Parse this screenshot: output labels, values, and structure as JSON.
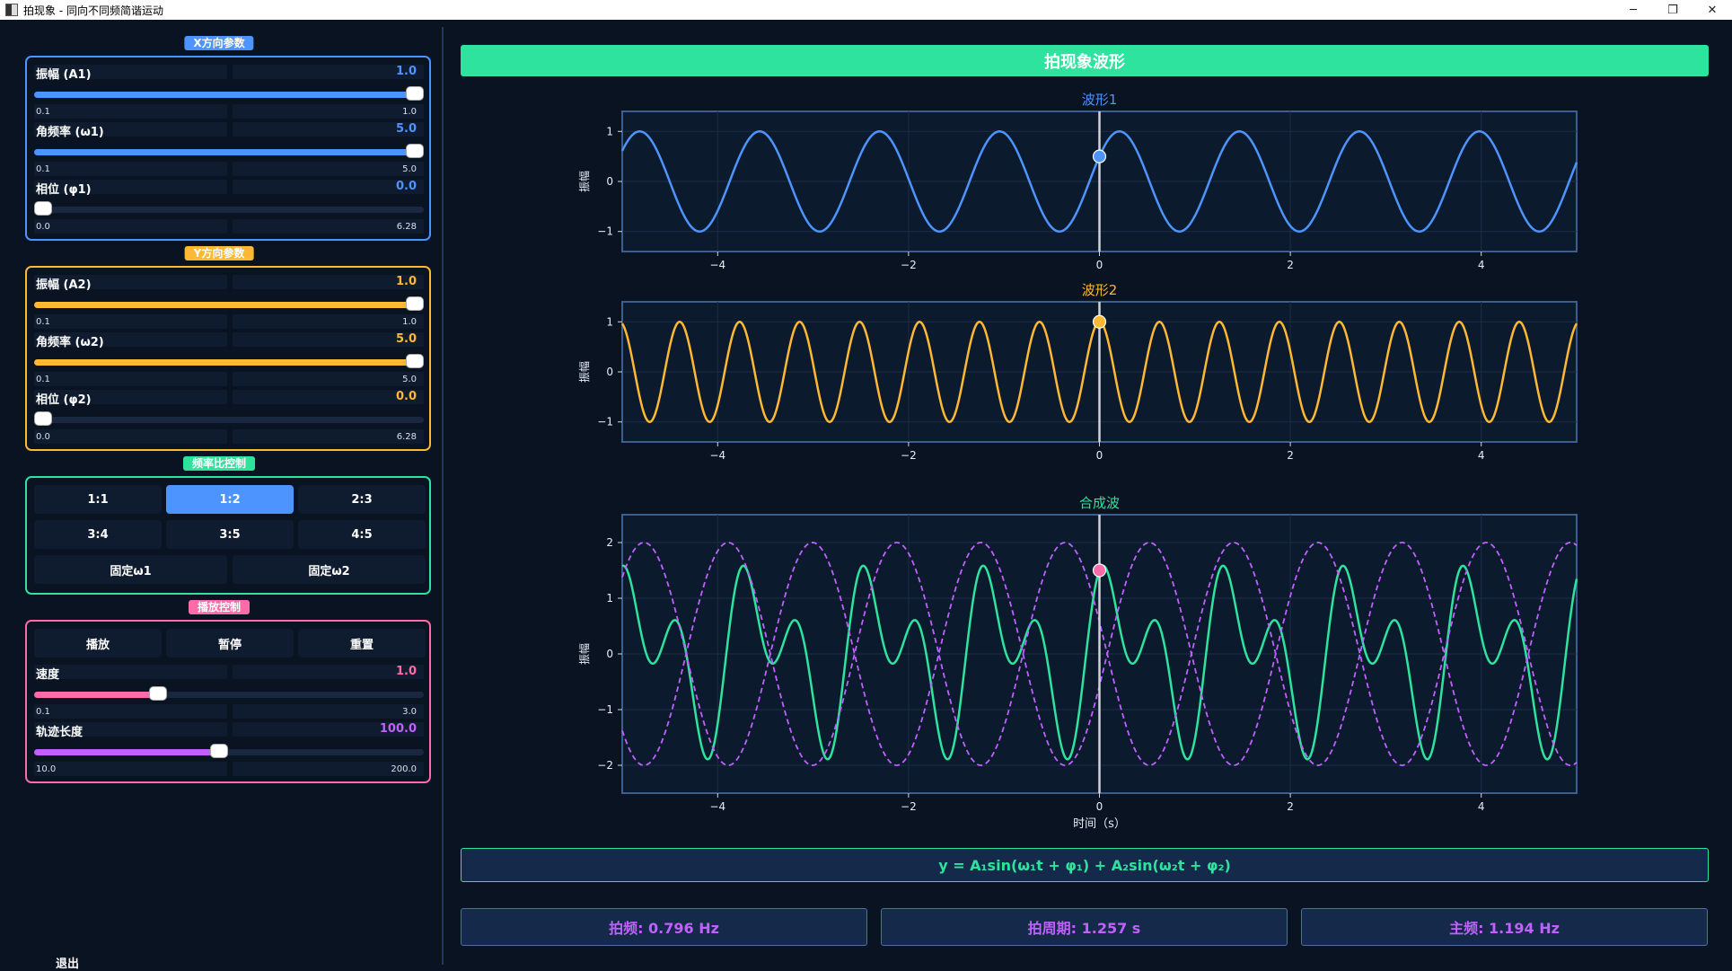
{
  "window": {
    "title": "拍现象 - 同向不同频简谐运动",
    "min_glyph": "─",
    "max_glyph": "❐",
    "close_glyph": "✕"
  },
  "x_params": {
    "title": "X方向参数",
    "color": "#4d94ff",
    "amplitude": {
      "label": "振幅 (A1)",
      "value": "1.0",
      "min": "0.1",
      "max": "1.0",
      "fraction": 1.0
    },
    "omega": {
      "label": "角频率 (ω1)",
      "value": "5.0",
      "min": "0.1",
      "max": "5.0",
      "fraction": 1.0
    },
    "phase": {
      "label": "相位 (φ1)",
      "value": "0.0",
      "min": "0.0",
      "max": "6.28",
      "fraction": 0.0
    }
  },
  "y_params": {
    "title": "Y方向参数",
    "color": "#ffb833",
    "amplitude": {
      "label": "振幅 (A2)",
      "value": "1.0",
      "min": "0.1",
      "max": "1.0",
      "fraction": 1.0
    },
    "omega": {
      "label": "角频率 (ω2)",
      "value": "5.0",
      "min": "0.1",
      "max": "5.0",
      "fraction": 1.0
    },
    "phase": {
      "label": "相位 (φ2)",
      "value": "0.0",
      "min": "0.0",
      "max": "6.28",
      "fraction": 0.0
    }
  },
  "ratio_control": {
    "title": "频率比控制",
    "color": "#2ee39e",
    "buttons": [
      "1:1",
      "1:2",
      "2:3",
      "3:4",
      "3:5",
      "4:5"
    ],
    "active": "1:2",
    "fix_w1": "固定ω1",
    "fix_w2": "固定ω2"
  },
  "playback": {
    "title": "播放控制",
    "color": "#ff6aa8",
    "play": "播放",
    "pause": "暂停",
    "reset": "重置",
    "speed": {
      "label": "速度",
      "value": "1.0",
      "min": "0.1",
      "max": "3.0",
      "fraction": 0.31
    },
    "trail": {
      "label": "轨迹长度",
      "value": "100.0",
      "min": "10.0",
      "max": "200.0",
      "fraction": 0.474
    }
  },
  "exit_label": "退出",
  "banner": "拍现象波形",
  "plots": {
    "wave1": {
      "title": "波形1",
      "ylabel": "振幅",
      "color": "#4d94ff",
      "A": 1.0,
      "omega": 5.0,
      "phi": 0.0,
      "type": "line",
      "xlim": [
        -5,
        5
      ],
      "ylim": [
        -1.4,
        1.4
      ]
    },
    "wave2": {
      "title": "波形2",
      "ylabel": "振幅",
      "color": "#ffb833",
      "A": 1.0,
      "omega": 10.0,
      "phi": 0.0,
      "type": "line",
      "xlim": [
        -5,
        5
      ],
      "ylim": [
        -1.4,
        1.4
      ]
    },
    "combined": {
      "title": "合成波",
      "ylabel": "振幅",
      "xlabel": "时间（s）",
      "color": "#2ee39e",
      "envelope_color": "#c061ff",
      "type": "line",
      "xlim": [
        -5,
        5
      ],
      "ylim": [
        -2.5,
        2.5
      ]
    },
    "cursor_t": 0.0,
    "xticks": [
      "−4",
      "−2",
      "0",
      "2",
      "4"
    ],
    "xtick_values": [
      -4,
      -2,
      0,
      2,
      4
    ],
    "yticks_small": [
      "1",
      "0",
      "−1"
    ],
    "yticks_small_values": [
      1,
      0,
      -1
    ],
    "yticks_big": [
      "2",
      "1",
      "0",
      "−1",
      "−2"
    ],
    "yticks_big_values": [
      2,
      1,
      0,
      -1,
      -2
    ]
  },
  "formula": "y = A₁sin(ω₁t + φ₁) + A₂sin(ω₂t + φ₂)",
  "stats": {
    "beat_freq": "拍频: 0.796 Hz",
    "beat_period": "拍周期: 1.257 s",
    "main_freq": "主频: 1.194 Hz"
  }
}
